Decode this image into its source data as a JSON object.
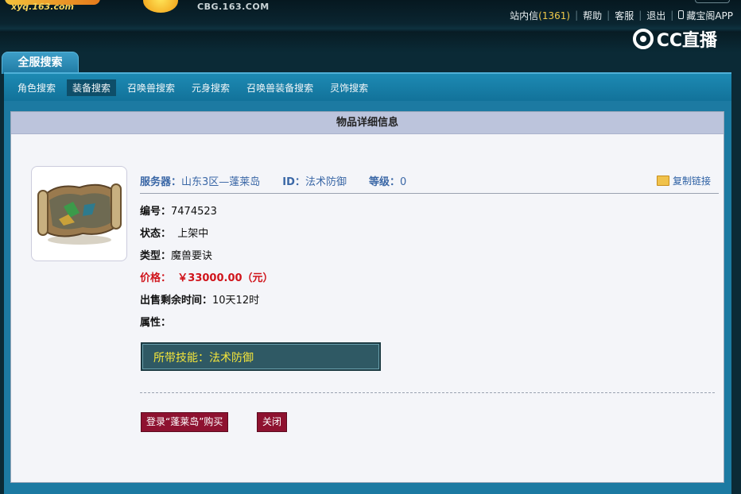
{
  "header": {
    "logo_url_text": "xyq.163.com",
    "site_text": "CBG.163.COM",
    "top_links": {
      "messages_label": "站内信",
      "messages_count": "(1361)",
      "help": "帮助",
      "service": "客服",
      "logout": "退出",
      "app": "藏宝阁APP"
    },
    "cc_logo_text": "CC直播"
  },
  "main_tab": "全服搜索",
  "subnav": [
    {
      "label": "角色搜索",
      "active": false
    },
    {
      "label": "装备搜索",
      "active": true
    },
    {
      "label": "召唤兽搜索",
      "active": false
    },
    {
      "label": "元身搜索",
      "active": false
    },
    {
      "label": "召唤兽装备搜索",
      "active": false
    },
    {
      "label": "灵饰搜索",
      "active": false
    }
  ],
  "panel": {
    "title": "物品详细信息",
    "server_label": "服务器：",
    "server_value": "山东3区—蓬莱岛",
    "id_label": "ID：",
    "id_value": "法术防御",
    "level_label": "等级：",
    "level_value": "0",
    "copy_link": "复制链接",
    "details": {
      "number_label": "编号：",
      "number_value": "7474523",
      "status_label": "状态：",
      "status_value": "上架中",
      "type_label": "类型：",
      "type_value": "魔兽要诀",
      "price_label": "价格：",
      "price_value": "￥33000.00（元）",
      "remaining_label": "出售剩余时间：",
      "remaining_value": "10天12时",
      "attr_label": "属性："
    },
    "skill_text": "所带技能：法术防御",
    "buy_button": "登录“蓬莱岛”购买",
    "close_button": "关闭"
  },
  "colors": {
    "accent_blue": "#1c7aa2",
    "price_red": "#d0141b",
    "button_maroon": "#8e1230",
    "skill_yellow": "#f4e53a"
  }
}
